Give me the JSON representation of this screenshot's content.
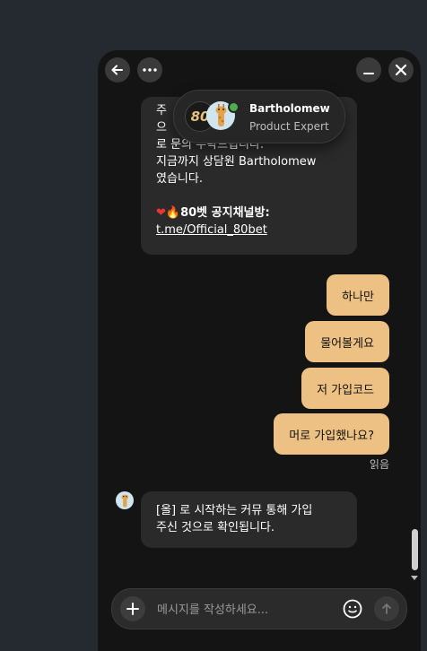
{
  "header": {
    "agent_name": "Bartholomew",
    "agent_role": "Product Expert",
    "brand_logo_text": "80"
  },
  "messages": {
    "agent_block_1": {
      "line1": "주",
      "line2": "으",
      "line3": "로 문의 부탁드립니다.",
      "line4": "지금까지 상담원 Bartholomew",
      "line5": "였습니다.",
      "notice_label": "80벳 공지채널방:",
      "notice_link": "t.me/Official_80bet"
    },
    "user_1": "하나만",
    "user_2": "물어볼게요",
    "user_3": "저 가입코드",
    "user_4": "머로 가입했나요?",
    "read_status": "읽음",
    "agent_block_2": {
      "line1": "[올] 로 시작하는 커뮤 통해 가입",
      "line2": "주신 것으로 확인됩니다."
    }
  },
  "composer": {
    "placeholder": "메시지를 작성하세요..."
  },
  "colors": {
    "user_bubble": "#edc083",
    "agent_bubble": "#2a2a2a",
    "panel": "#141414",
    "online": "#4caf50"
  }
}
